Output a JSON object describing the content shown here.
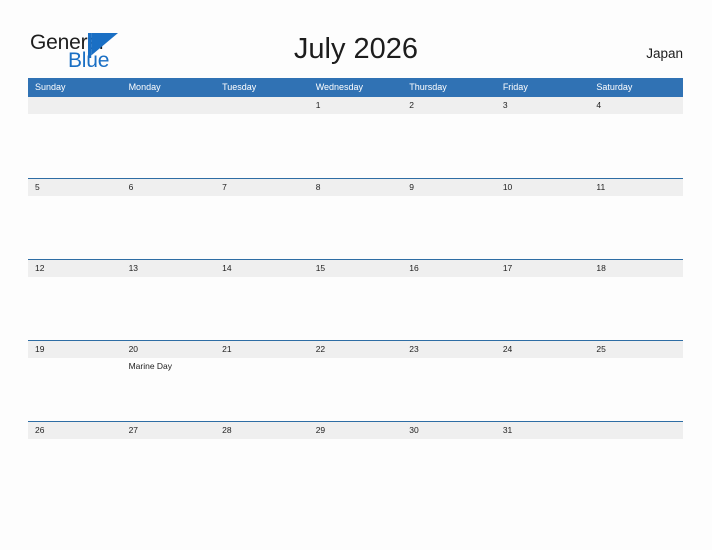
{
  "brand": {
    "name_part1": "General",
    "name_part2": "Blue",
    "flag_icon": "blue-triangle-flag-icon",
    "color_primary": "#1a6fc4",
    "color_text": "#1d1d1d"
  },
  "header": {
    "title": "July 2026",
    "country": "Japan"
  },
  "theme": {
    "header_blue": "#3072b4",
    "row_line_blue": "#2e6da4",
    "band_gray": "#efefef",
    "page_background": "#fdfdfd"
  },
  "calendar": {
    "month": "July",
    "year": "2026",
    "weekday_headers": [
      "Sunday",
      "Monday",
      "Tuesday",
      "Wednesday",
      "Thursday",
      "Friday",
      "Saturday"
    ],
    "weeks": [
      {
        "days": [
          {
            "date": "",
            "events": []
          },
          {
            "date": "",
            "events": []
          },
          {
            "date": "",
            "events": []
          },
          {
            "date": "1",
            "events": []
          },
          {
            "date": "2",
            "events": []
          },
          {
            "date": "3",
            "events": []
          },
          {
            "date": "4",
            "events": []
          }
        ]
      },
      {
        "days": [
          {
            "date": "5",
            "events": []
          },
          {
            "date": "6",
            "events": []
          },
          {
            "date": "7",
            "events": []
          },
          {
            "date": "8",
            "events": []
          },
          {
            "date": "9",
            "events": []
          },
          {
            "date": "10",
            "events": []
          },
          {
            "date": "11",
            "events": []
          }
        ]
      },
      {
        "days": [
          {
            "date": "12",
            "events": []
          },
          {
            "date": "13",
            "events": []
          },
          {
            "date": "14",
            "events": []
          },
          {
            "date": "15",
            "events": []
          },
          {
            "date": "16",
            "events": []
          },
          {
            "date": "17",
            "events": []
          },
          {
            "date": "18",
            "events": []
          }
        ]
      },
      {
        "days": [
          {
            "date": "19",
            "events": []
          },
          {
            "date": "20",
            "events": [
              "Marine Day"
            ]
          },
          {
            "date": "21",
            "events": []
          },
          {
            "date": "22",
            "events": []
          },
          {
            "date": "23",
            "events": []
          },
          {
            "date": "24",
            "events": []
          },
          {
            "date": "25",
            "events": []
          }
        ]
      },
      {
        "days": [
          {
            "date": "26",
            "events": []
          },
          {
            "date": "27",
            "events": []
          },
          {
            "date": "28",
            "events": []
          },
          {
            "date": "29",
            "events": []
          },
          {
            "date": "30",
            "events": []
          },
          {
            "date": "31",
            "events": []
          },
          {
            "date": "",
            "events": []
          }
        ]
      }
    ]
  }
}
